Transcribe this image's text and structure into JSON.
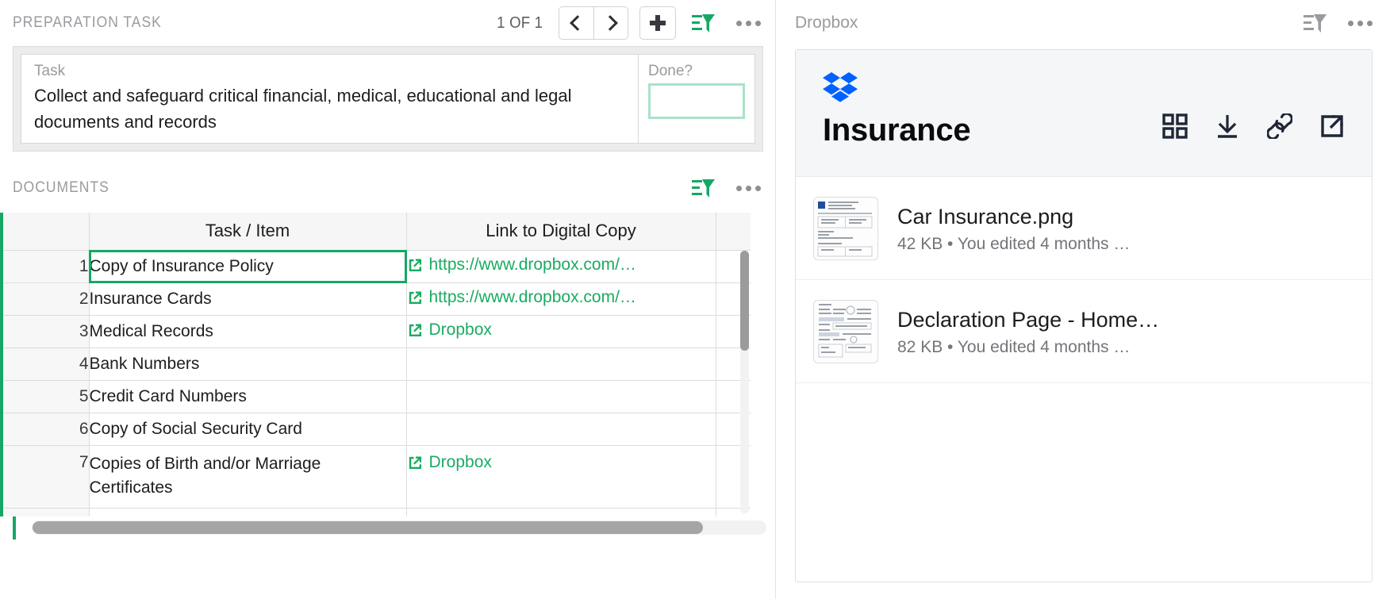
{
  "left": {
    "section_title": "PREPARATION TASK",
    "counter": "1 OF 1",
    "prev_label": "Previous record",
    "next_label": "Next record",
    "add_label": "Add record",
    "filter_label": "Filter",
    "more_label": "More options",
    "task_card": {
      "field_label": "Task",
      "field_value": "Collect and safeguard critical financial, medical, educational and legal documents and records",
      "done_label": "Done?",
      "done_value": ""
    },
    "documents": {
      "section_title": "DOCUMENTS",
      "filter_label": "Filter",
      "more_label": "More options",
      "columns": [
        "",
        "Task / Item",
        "Link to Digital Copy",
        ""
      ],
      "rows": [
        {
          "num": "1",
          "item": "Copy of Insurance Policy",
          "link": "https://www.dropbox.com/…",
          "selected": true
        },
        {
          "num": "2",
          "item": "Insurance Cards",
          "link": "https://www.dropbox.com/…",
          "selected": false
        },
        {
          "num": "3",
          "item": "Medical Records",
          "link": "Dropbox",
          "selected": false
        },
        {
          "num": "4",
          "item": "Bank Numbers",
          "link": "",
          "selected": false
        },
        {
          "num": "5",
          "item": "Credit Card Numbers",
          "link": "",
          "selected": false
        },
        {
          "num": "6",
          "item": "Copy of Social Security Card",
          "link": "",
          "selected": false
        },
        {
          "num": "7",
          "item": "Copies of Birth and/or Marriage Certificates",
          "link": "Dropbox",
          "selected": false
        }
      ]
    }
  },
  "right": {
    "section_title": "Dropbox",
    "filter_label": "Filter",
    "more_label": "More options",
    "card": {
      "logo_name": "dropbox-logo",
      "folder_title": "Insurance",
      "actions": [
        {
          "name": "grid-view-icon",
          "label": "Grid view"
        },
        {
          "name": "download-icon",
          "label": "Download"
        },
        {
          "name": "link-icon",
          "label": "Copy link"
        },
        {
          "name": "open-external-icon",
          "label": "Open in Dropbox"
        }
      ],
      "files": [
        {
          "name": "Car Insurance.png",
          "meta": "42 KB • You edited 4 months …"
        },
        {
          "name": "Declaration Page - Home…",
          "meta": "82 KB • You edited 4 months …"
        }
      ]
    }
  },
  "colors": {
    "accent_green": "#16a765",
    "link_green": "#1aab62",
    "mint_border": "#a8e3c8",
    "dropbox_blue": "#0061ff",
    "header_gray": "#9a9a9f"
  }
}
